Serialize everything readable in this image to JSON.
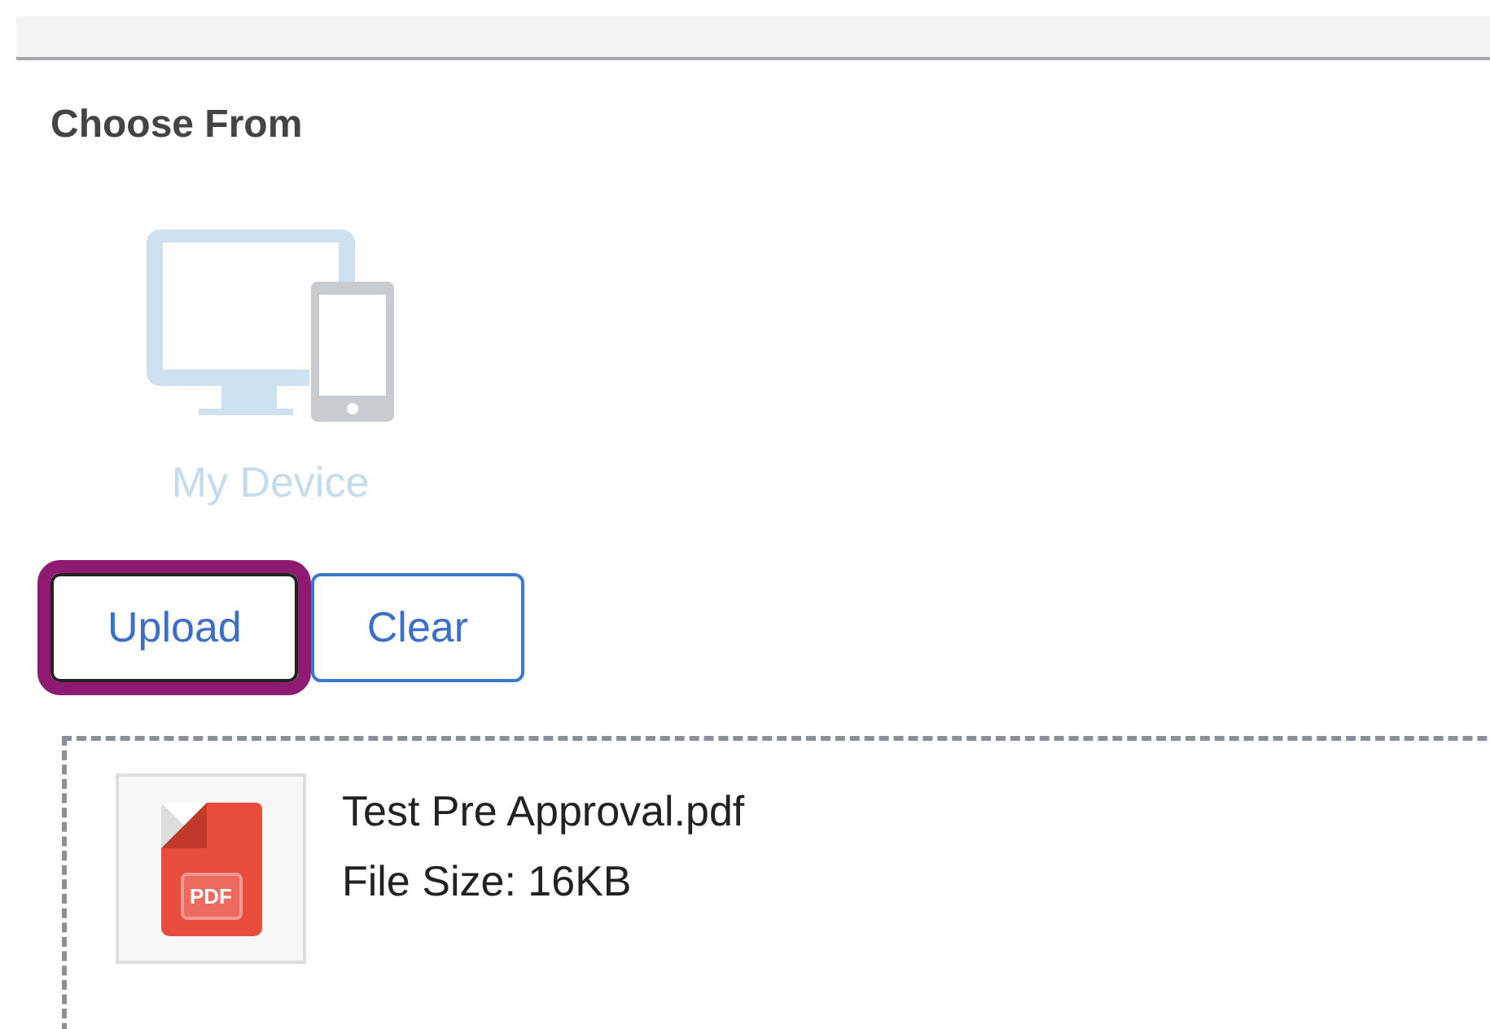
{
  "heading": "Choose From",
  "sources": [
    {
      "label": "My Device",
      "selected": false
    }
  ],
  "buttons": [
    {
      "label": "Upload",
      "focused": true
    },
    {
      "label": "Clear",
      "focused": false
    }
  ],
  "files": [
    {
      "icon_label": "PDF",
      "name": "Test Pre Approval.pdf",
      "size": "File Size: 16KB"
    }
  ]
}
